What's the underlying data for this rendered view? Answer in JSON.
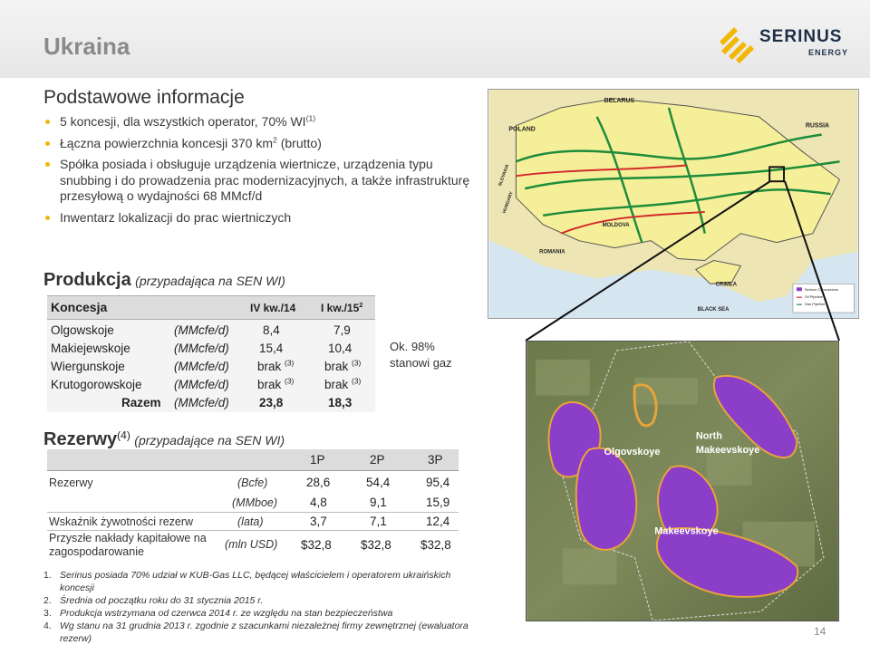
{
  "header": {
    "title": "Ukraina",
    "logo_name": "SERINUS",
    "logo_sub": "ENERGY"
  },
  "section_basic": {
    "heading": "Podstawowe informacje",
    "bullets": [
      {
        "text": "5 koncesji, dla wszystkich operator, 70% WI",
        "sup": "(1)"
      },
      {
        "text": "Łączna powierzchnia koncesji 370 km",
        "sup": "2",
        "tail": " (brutto)"
      },
      {
        "text": "Spółka posiada i obsługuje urządzenia wiertnicze, urządzenia typu snubbing i do prowadzenia prac modernizacyjnych, a także infrastrukturę przesyłową  o wydajności 68 MMcf/d"
      },
      {
        "text": "Inwentarz lokalizacji do prac wiertniczych"
      }
    ]
  },
  "section_production": {
    "heading": "Produkcja",
    "subheading": "(przypadająca na SEN WI)",
    "columns": {
      "name": "Koncesja",
      "q1": "IV kw./14",
      "q2": "I kw./15",
      "q2_sup": "2"
    },
    "rows": [
      {
        "name": "Olgowskoje",
        "unit": "(MMcfe/d)",
        "v1": "8,4",
        "v2": "7,9"
      },
      {
        "name": "Makiejewskoje",
        "unit": "(MMcfe/d)",
        "v1": "15,4",
        "v2": "10,4"
      },
      {
        "name": "Wiergunskoje",
        "unit": "(MMcfe/d)",
        "v1": "brak",
        "v1_sup": "(3)",
        "v2": "brak",
        "v2_sup": "(3)"
      },
      {
        "name": "Krutogorowskoje",
        "unit": "(MMcfe/d)",
        "v1": "brak",
        "v1_sup": "(3)",
        "v2": "brak",
        "v2_sup": "(3)"
      },
      {
        "name": "Razem",
        "unit": "(MMcfe/d)",
        "v1": "23,8",
        "v2": "18,3"
      }
    ],
    "note": "Ok. 98% stanowi gaz"
  },
  "section_reserves": {
    "heading": "Rezerwy",
    "heading_sup": "(4)",
    "subheading": "(przypadające na SEN WI)",
    "columns": [
      "1P",
      "2P",
      "3P"
    ],
    "rows": [
      {
        "label": "Rezerwy",
        "unit": "(Bcfe)",
        "values": [
          "28,6",
          "54,4",
          "95,4"
        ]
      },
      {
        "label": "",
        "unit": "(MMboe)",
        "values": [
          "4,8",
          "9,1",
          "15,9"
        ]
      },
      {
        "label": "Wskaźnik żywotności rezerw",
        "unit": "(lata)",
        "values": [
          "3,7",
          "7,1",
          "12,4"
        ]
      },
      {
        "label": "Przyszłe nakłady kapitałowe na zagospodarowanie",
        "unit": "(mln USD)",
        "values": [
          "$32,8",
          "$32,8",
          "$32,8"
        ]
      }
    ]
  },
  "footnotes": [
    "Serinus posiada 70% udział w KUB-Gas LLC, będącej właścicielem i operatorem ukraińskich koncesji",
    "Średnia od początku roku do 31 stycznia 2015 r.",
    "Produkcja wstrzymana od czerwca 2014 r. ze względu na stan bezpieczeństwa",
    "Wg stanu na 31 grudnia 2013 r. zgodnie z szacunkami niezależnej firmy zewnętrznej (ewaluatora rezerw)"
  ],
  "map": {
    "labels": {
      "belarus": "BELARUS",
      "poland": "POLAND",
      "russia": "RUSSIA",
      "moldova": "MOLDOVA",
      "romania": "ROMANIA",
      "crimea": "CRIMEA",
      "black_sea": "BLACK SEA",
      "slovakia": "SLOVAKIA",
      "hungary": "HUNGARY"
    },
    "legend": [
      "Serinus Concessions",
      "Oil Pipeline",
      "Gas Pipeline"
    ]
  },
  "satellite": {
    "labels": {
      "olgovskoye": "Olgovskoye",
      "north_1": "North",
      "north_2": "Makeevskoye",
      "makeevskoye": "Makeevskoye"
    }
  },
  "page_number": "14",
  "colors": {
    "bullet": "#f2b705",
    "brand_navy": "#1d2f47",
    "concession_purple": "#8b3fc9",
    "concession_orange": "#e8a33a",
    "pipeline_green": "#1e8c3a",
    "pipeline_red": "#d22a2a"
  }
}
